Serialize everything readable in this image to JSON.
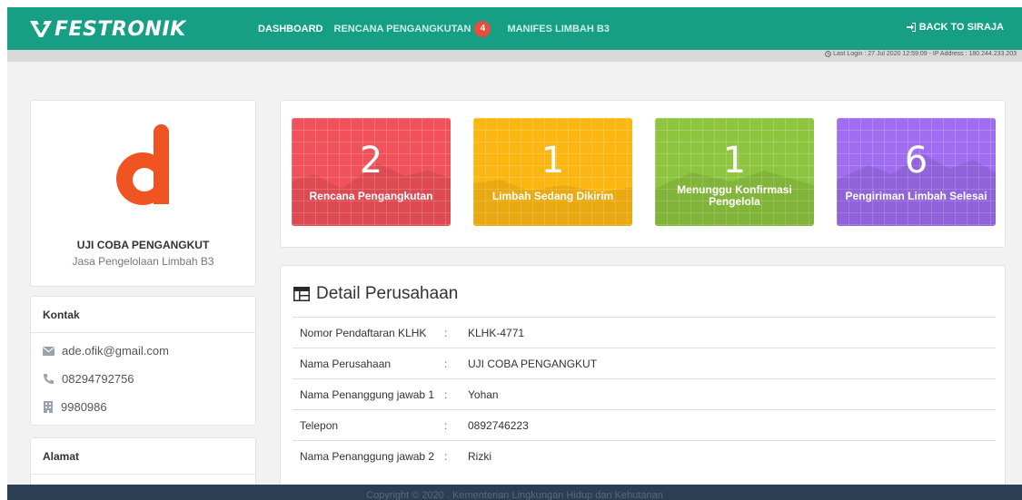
{
  "brand": {
    "name": "FESTRONIK",
    "color": "#169f85"
  },
  "nav": {
    "items": [
      {
        "label": "DASHBOARD",
        "active": true
      },
      {
        "label": "RENCANA PENGANGKUTAN",
        "badge": "4"
      },
      {
        "label": "MANIFES LIMBAH B3"
      }
    ],
    "back_label": "BACK TO SIRAJA"
  },
  "last_login": "Last Login : 27 Jul 2020 12:59:09 - IP Address : 180.244.233.203",
  "profile": {
    "name": "UJI COBA PENGANGKUT",
    "type": "Jasa Pengelolaan Limbah B3",
    "logo_color": "#f05423"
  },
  "contact": {
    "heading": "Kontak",
    "email": "ade.ofik@gmail.com",
    "phone": "08294792756",
    "fax": "9980986"
  },
  "address": {
    "heading": "Alamat"
  },
  "stats": [
    {
      "value": "2",
      "label": "Rencana Pengangkutan",
      "color": "#f0515a"
    },
    {
      "value": "1",
      "label": "Limbah Sedang Dikirim",
      "color": "#fbb612"
    },
    {
      "value": "1",
      "label": "Menunggu Konfirmasi Pengelola",
      "color": "#8dc53e"
    },
    {
      "value": "6",
      "label": "Pengiriman Limbah Selesai",
      "color": "#a06df0"
    }
  ],
  "detail": {
    "title": "Detail Perusahaan",
    "separator": ":",
    "rows": [
      {
        "key": "Nomor Pendaftaran KLHK",
        "value": "KLHK-4771"
      },
      {
        "key": "Nama Perusahaan",
        "value": "UJI COBA PENGANGKUT"
      },
      {
        "key": "Nama Penanggung jawab 1",
        "value": "Yohan"
      },
      {
        "key": "Telepon",
        "value": "0892746223"
      },
      {
        "key": "Nama Penanggung jawab 2",
        "value": "Rizki"
      }
    ]
  },
  "footer": "Copyright © 2020 . Kementerian Lingkungan Hidup dan Kehutanan"
}
